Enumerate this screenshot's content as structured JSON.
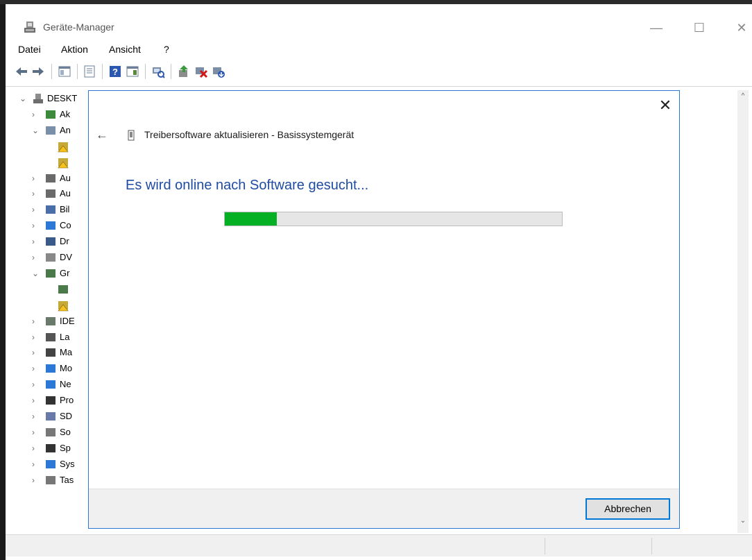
{
  "window": {
    "title": "Geräte-Manager",
    "minimize_glyph": "—",
    "maximize_glyph": "☐",
    "close_glyph": "✕"
  },
  "menu": {
    "items": [
      "Datei",
      "Aktion",
      "Ansicht",
      "?"
    ]
  },
  "toolbar": {
    "icons": [
      "back-arrow-icon",
      "forward-arrow-icon",
      "console-tree-icon",
      "properties-icon",
      "help-icon",
      "action-pane-icon",
      "scan-hardware-icon",
      "update-driver-icon",
      "disable-device-icon",
      "uninstall-device-icon"
    ]
  },
  "tree": {
    "root_label": "DESKT",
    "items": [
      {
        "label": "Ak",
        "expander": "›",
        "icon": "audio-inputs-icon"
      },
      {
        "label": "An",
        "expander": "⌄",
        "icon": "other-devices-icon"
      },
      {
        "label": "",
        "expander": "",
        "icon": "warning-device-icon"
      },
      {
        "label": "",
        "expander": "",
        "icon": "warning-device-icon"
      },
      {
        "label": "Au",
        "expander": "›",
        "icon": "speaker-icon"
      },
      {
        "label": "Au",
        "expander": "›",
        "icon": "speaker-icon"
      },
      {
        "label": "Bil",
        "expander": "›",
        "icon": "imaging-device-icon"
      },
      {
        "label": "Co",
        "expander": "›",
        "icon": "computer-icon"
      },
      {
        "label": "Dr",
        "expander": "›",
        "icon": "printer-icon"
      },
      {
        "label": "DV",
        "expander": "›",
        "icon": "dvd-drive-icon"
      },
      {
        "label": "Gr",
        "expander": "⌄",
        "icon": "display-adapter-icon"
      },
      {
        "label": "",
        "expander": "",
        "icon": "display-adapter-icon"
      },
      {
        "label": "",
        "expander": "",
        "icon": "display-adapter-warning-icon"
      },
      {
        "label": "IDE",
        "expander": "›",
        "icon": "ide-controller-icon"
      },
      {
        "label": "La",
        "expander": "›",
        "icon": "disk-drive-icon"
      },
      {
        "label": "Ma",
        "expander": "›",
        "icon": "mouse-icon"
      },
      {
        "label": "Mo",
        "expander": "›",
        "icon": "monitor-icon"
      },
      {
        "label": "Ne",
        "expander": "›",
        "icon": "network-adapter-icon"
      },
      {
        "label": "Pro",
        "expander": "›",
        "icon": "processor-icon"
      },
      {
        "label": "SD",
        "expander": "›",
        "icon": "sd-host-icon"
      },
      {
        "label": "So",
        "expander": "›",
        "icon": "software-device-icon"
      },
      {
        "label": "Sp",
        "expander": "›",
        "icon": "storage-controller-icon"
      },
      {
        "label": "Sys",
        "expander": "›",
        "icon": "system-device-icon"
      },
      {
        "label": "Tas",
        "expander": "›",
        "icon": "keyboard-icon"
      }
    ]
  },
  "scrollbar": {
    "up_glyph": "^",
    "down_glyph": "⌄"
  },
  "dialog": {
    "close_glyph": "✕",
    "back_glyph": "←",
    "header": "Treibersoftware aktualisieren - Basissystemgerät",
    "message": "Es wird online nach Software gesucht...",
    "progress": 0.155,
    "cancel_label": "Abbrechen"
  },
  "colors": {
    "progress_fill": "#06b025",
    "dialog_border": "#2b78d6",
    "message_text": "#1f4ba3"
  }
}
